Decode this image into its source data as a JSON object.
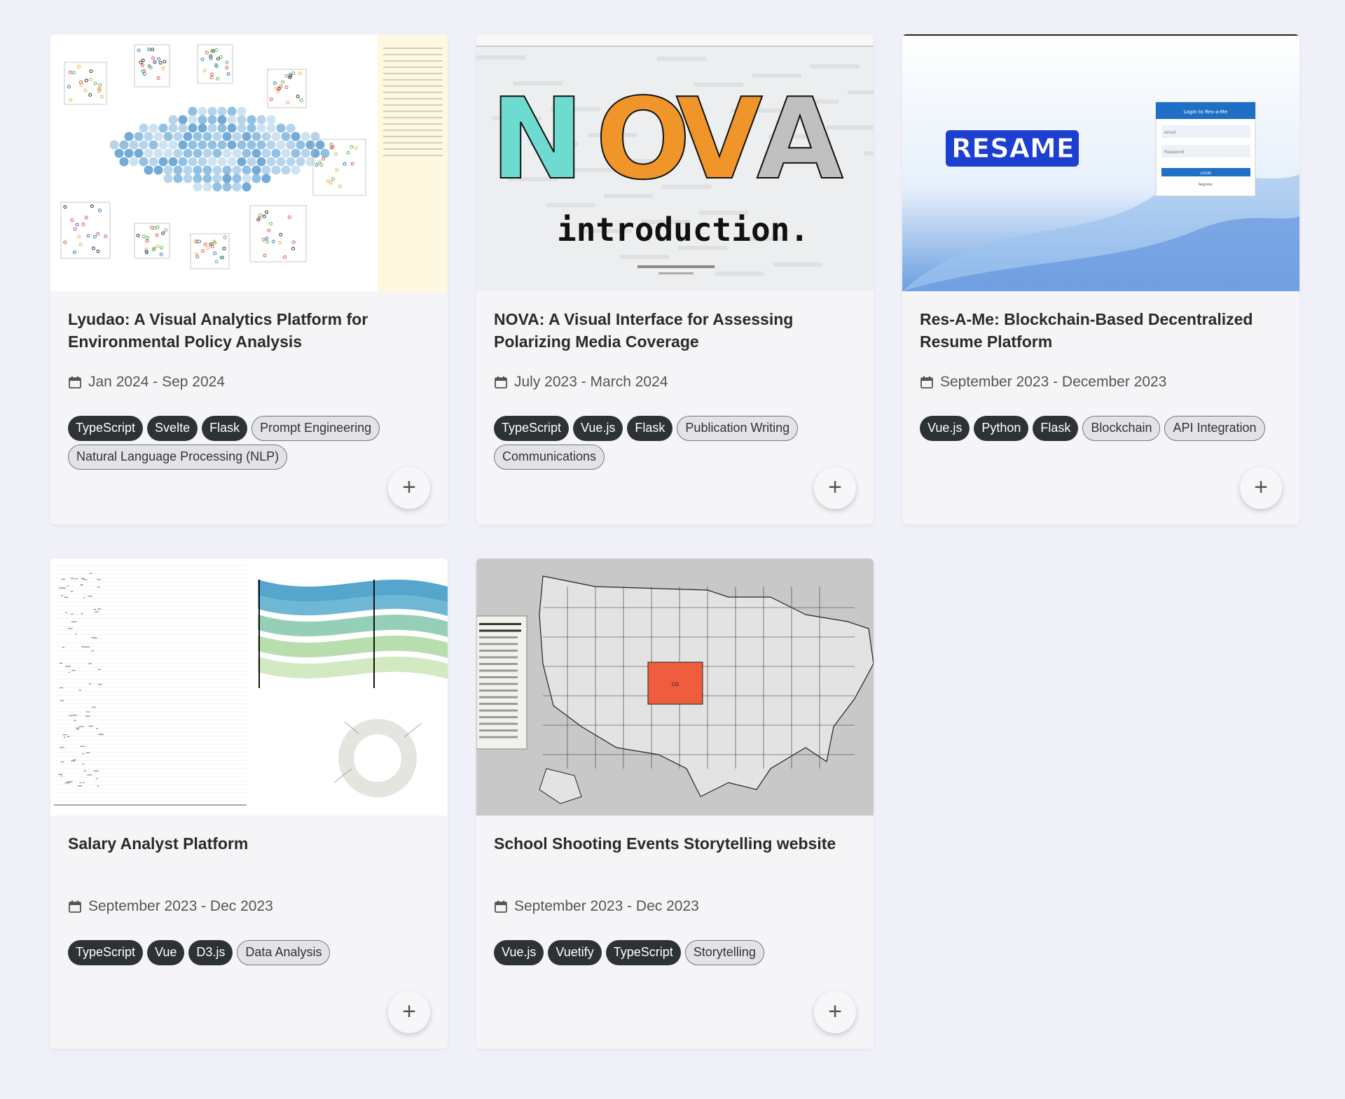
{
  "projects": [
    {
      "title": "Lyudao: A Visual Analytics Platform for Environmental Policy Analysis",
      "date": "Jan 2024 - Sep 2024",
      "tags": [
        {
          "label": "TypeScript",
          "style": "dark"
        },
        {
          "label": "Svelte",
          "style": "dark"
        },
        {
          "label": "Flask",
          "style": "dark"
        },
        {
          "label": "Prompt Engineering",
          "style": "light"
        },
        {
          "label": "Natural Language Processing (NLP)",
          "style": "light"
        }
      ],
      "thumbnail": "lyudao-visualization"
    },
    {
      "title": "NOVA: A Visual Interface for Assessing Polarizing Media Coverage",
      "date": "July 2023 - March 2024",
      "tags": [
        {
          "label": "TypeScript",
          "style": "dark"
        },
        {
          "label": "Vue.js",
          "style": "dark"
        },
        {
          "label": "Flask",
          "style": "dark"
        },
        {
          "label": "Publication Writing",
          "style": "light"
        },
        {
          "label": "Communications",
          "style": "light"
        }
      ],
      "thumbnail": "nova-introduction",
      "thumb_text": {
        "logo": "NOVA",
        "subtitle": "introduction"
      }
    },
    {
      "title": "Res-A-Me: Blockchain-Based Decentralized Resume Platform",
      "date": "September 2023 - December 2023",
      "tags": [
        {
          "label": "Vue.js",
          "style": "dark"
        },
        {
          "label": "Python",
          "style": "dark"
        },
        {
          "label": "Flask",
          "style": "dark"
        },
        {
          "label": "Blockchain",
          "style": "light"
        },
        {
          "label": "API Integration",
          "style": "light"
        }
      ],
      "thumbnail": "resame-login",
      "thumb_text": {
        "logo": "RESAME",
        "login_title": "Login to Res-a-Me",
        "email": "email",
        "password": "Password",
        "login_btn": "LOGIN",
        "register": "Register"
      }
    },
    {
      "title": "Salary Analyst Platform",
      "date": "September 2023 - Dec 2023",
      "tags": [
        {
          "label": "TypeScript",
          "style": "dark"
        },
        {
          "label": "Vue",
          "style": "dark"
        },
        {
          "label": "D3.js",
          "style": "dark"
        },
        {
          "label": "Data Analysis",
          "style": "light"
        }
      ],
      "thumbnail": "salary-charts"
    },
    {
      "title": "School Shooting Events Storytelling website",
      "date": "September 2023 - Dec 2023",
      "tags": [
        {
          "label": "Vue.js",
          "style": "dark"
        },
        {
          "label": "Vuetify",
          "style": "dark"
        },
        {
          "label": "TypeScript",
          "style": "dark"
        },
        {
          "label": "Storytelling",
          "style": "light"
        }
      ],
      "thumbnail": "us-map",
      "thumb_text": {
        "highlight_state": "CO",
        "highlight_color": "#ef5d3e"
      }
    }
  ],
  "colors": {
    "page_bg": "#f0f0f8",
    "card_bg": "#f5f5f8",
    "tag_dark": "#2c3236",
    "tag_light": "#e2e3e6"
  },
  "icons": {
    "date": "calendar-icon",
    "expand": "plus-icon"
  }
}
